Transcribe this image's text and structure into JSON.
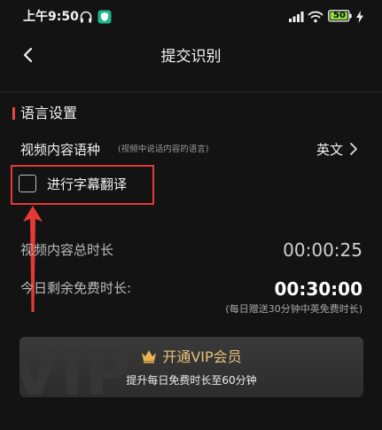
{
  "status_bar": {
    "time": "上午9:50",
    "battery": "50"
  },
  "nav": {
    "title": "提交识别"
  },
  "section": {
    "title": "语言设置",
    "video_language_label": "视频内容语种",
    "video_language_hint": "(视频中说话内容的语言)",
    "video_language_value": "英文",
    "subtitle_translate_label": "进行字幕翻译",
    "subtitle_translate_checked": false
  },
  "durations": {
    "total_label": "视频内容总时长",
    "total_value": "00:00:25",
    "free_label": "今日剩余免费时长:",
    "free_value": "00:30:00",
    "daily_note": "(每日赠送30分钟中英免费时长)"
  },
  "vip": {
    "title": "开通VIP会员",
    "subtitle": "提升每日免费时长至60分钟",
    "background_text": "VIP"
  },
  "colors": {
    "accent": "#e4473c",
    "gold": "#e7c27a",
    "background": "#131313"
  },
  "icons": [
    "headphones-icon",
    "shield-icon",
    "signal-icon",
    "wifi-icon",
    "battery-icon",
    "charging-icon",
    "back-arrow-icon",
    "chevron-right-icon",
    "crown-icon",
    "up-arrow-annotation"
  ]
}
